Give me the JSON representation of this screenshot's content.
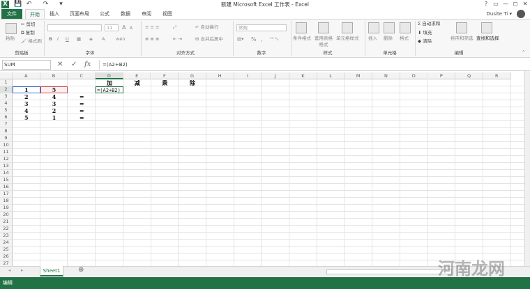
{
  "window": {
    "title": "新建 Microsoft Excel 工作表 - Excel",
    "help": "?",
    "restore": "▭",
    "minimize": "—",
    "maximize": "◻",
    "close": "✕"
  },
  "quick_access": {
    "excel_logo": "X",
    "save": "💾",
    "undo": "↶",
    "redo": "↷",
    "customize": "▾"
  },
  "tabs": [
    "文件",
    "开始",
    "插入",
    "页面布局",
    "公式",
    "数据",
    "审阅",
    "视图"
  ],
  "user": {
    "name": "Dusite Ti",
    "chevron": "▾"
  },
  "ribbon": {
    "clipboard": {
      "paste": "粘贴",
      "cut": "剪切",
      "copy": "复制",
      "format_painter": "格式刷",
      "group": "剪贴板"
    },
    "font": {
      "font_name": "",
      "font_size": "11",
      "bold": "B",
      "italic": "I",
      "underline": "U",
      "grow": "A",
      "shrink": "A",
      "wen": "wén",
      "group": "字体"
    },
    "alignment": {
      "wrap": "自动换行",
      "merge": "合并后居中",
      "group": "对齐方式"
    },
    "number": {
      "format": "常规",
      "percent": "%",
      "comma": ",",
      "group": "数字"
    },
    "styles": {
      "conditional": "条件格式",
      "table": "套用表格格式",
      "cell": "单元格样式",
      "group": "样式"
    },
    "cells": {
      "insert": "插入",
      "delete": "删除",
      "format": "格式",
      "group": "单元格"
    },
    "editing": {
      "autosum": "自动求和",
      "fill": "填充",
      "clear": "清除",
      "sort": "排序和筛选",
      "find": "查找和选择",
      "group": "编辑"
    }
  },
  "formula_bar": {
    "name_box": "SUM",
    "cancel": "✕",
    "enter": "✓",
    "fx": "fx",
    "formula": "=(A2+B2)"
  },
  "columns": [
    "A",
    "B",
    "C",
    "D",
    "E",
    "F",
    "G",
    "H",
    "I",
    "J",
    "K",
    "L",
    "M",
    "N",
    "O",
    "P",
    "Q",
    "R"
  ],
  "rows": [
    "1",
    "2",
    "3",
    "4",
    "5",
    "6",
    "7",
    "8",
    "9",
    "10",
    "11",
    "12",
    "13",
    "14",
    "15",
    "16",
    "17",
    "18",
    "19",
    "20",
    "21",
    "22",
    "23",
    "24",
    "25",
    "26",
    "27"
  ],
  "cells": {
    "D1": "加",
    "E1": "减",
    "F1": "乘",
    "G1": "除",
    "A2": "1",
    "B2": "5",
    "D2": "=(A2+B2)",
    "A3": "2",
    "B3": "4",
    "C3": "=",
    "A4": "3",
    "B4": "3",
    "C4": "=",
    "A5": "4",
    "B5": "2",
    "C5": "=",
    "A6": "5",
    "B6": "1",
    "C6": "="
  },
  "sheets": {
    "active": "Sheet1",
    "add": "⊕",
    "prev": "◂",
    "next": "▸"
  },
  "status": {
    "mode": "编辑"
  },
  "watermark": {
    "text": "河南龙网"
  }
}
